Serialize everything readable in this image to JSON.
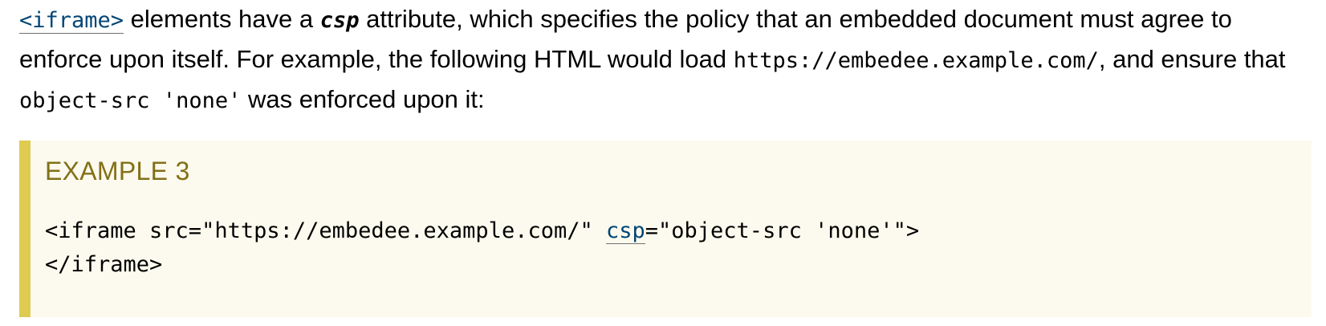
{
  "paragraph": {
    "iframe_link": "<iframe>",
    "text_1": " elements have a ",
    "attr_name": "csp",
    "text_2": " attribute, which specifies the policy that an embedded document must agree to enforce upon itself. For example, the following HTML would load ",
    "url_code": "https://embedee.example.com/",
    "text_3": ", and ensure that ",
    "policy_code": "object-src 'none'",
    "text_4": " was enforced upon it:"
  },
  "example": {
    "title": "EXAMPLE 3",
    "code_part_1": "<iframe src=\"https://embedee.example.com/\" ",
    "code_link": "csp",
    "code_part_2": "=\"object-src 'none'\">",
    "code_line_2": "</iframe>"
  },
  "colors": {
    "link": "#034575",
    "example_bg": "#fcfaee",
    "example_border": "#e0cb52",
    "example_title": "#827017"
  }
}
